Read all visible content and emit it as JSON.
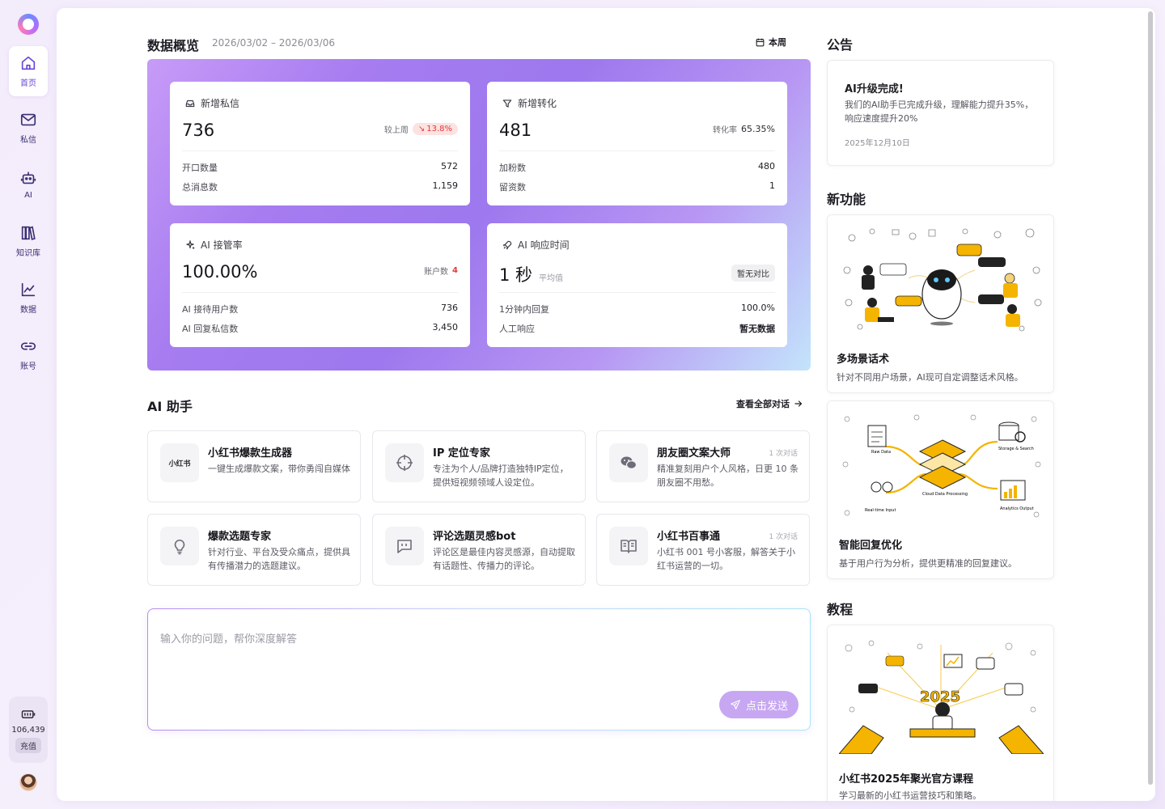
{
  "sidebar": {
    "items": [
      {
        "label": "首页",
        "icon": "home-icon",
        "active": true
      },
      {
        "label": "私信",
        "icon": "mail-icon"
      },
      {
        "label": "AI",
        "icon": "robot-icon"
      },
      {
        "label": "知识库",
        "icon": "books-icon"
      },
      {
        "label": "数据",
        "icon": "chart-line-icon"
      },
      {
        "label": "账号",
        "icon": "link-icon"
      }
    ],
    "credits": {
      "value": "106,439",
      "recharge_label": "充值"
    }
  },
  "overview": {
    "title": "数据概览",
    "date_range": "2026/03/02 – 2026/03/06",
    "period_button": "本周",
    "cards": [
      {
        "title": "新增私信",
        "value": "736",
        "meta_label": "较上周",
        "trend": "13.8%",
        "rows": [
          {
            "k": "开口数量",
            "v": "572"
          },
          {
            "k": "总消息数",
            "v": "1,159"
          }
        ]
      },
      {
        "title": "新增转化",
        "value": "481",
        "meta_label": "转化率",
        "meta_value": "65.35%",
        "rows": [
          {
            "k": "加粉数",
            "v": "480"
          },
          {
            "k": "留资数",
            "v": "1"
          }
        ]
      },
      {
        "title": "AI 接管率",
        "value": "100.00%",
        "meta_label": "账户数",
        "meta_value": "4",
        "rows": [
          {
            "k": "AI 接待用户数",
            "v": "736"
          },
          {
            "k": "AI 回复私信数",
            "v": "3,450"
          }
        ]
      },
      {
        "title": "AI 响应时间",
        "value": "1 秒",
        "value_sub": "平均值",
        "meta_badge": "暂无对比",
        "rows": [
          {
            "k": "1分钟内回复",
            "v": "100.0%"
          },
          {
            "k": "人工响应",
            "v": "暂无数据"
          }
        ]
      }
    ]
  },
  "assistant": {
    "title": "AI 助手",
    "view_all": "查看全部对话",
    "tools": [
      {
        "title": "小红书爆款生成器",
        "desc": "一键生成爆款文案，带你勇闯自媒体",
        "icon_text": "小红书",
        "count": ""
      },
      {
        "title": "IP 定位专家",
        "desc": "专注为个人/品牌打造独特IP定位，提供短视频领域人设定位。",
        "icon": "crosshair-icon",
        "count": ""
      },
      {
        "title": "朋友圈文案大师",
        "desc": "精准复刻用户个人风格，日更 10 条朋友圈不用愁。",
        "icon": "wechat-icon",
        "count": "1 次对话"
      },
      {
        "title": "爆款选题专家",
        "desc": "针对行业、平台及受众痛点，提供具有传播潜力的选题建议。",
        "icon": "lightbulb-icon",
        "count": ""
      },
      {
        "title": "评论选题灵感bot",
        "desc": "评论区是最佳内容灵感源，自动提取有话题性、传播力的评论。",
        "icon": "quote-bubble-icon",
        "count": ""
      },
      {
        "title": "小红书百事通",
        "desc": "小红书 001 号小客服，解答关于小红书运营的一切。",
        "icon": "open-book-icon",
        "count": "1 次对话"
      }
    ],
    "input_placeholder": "输入你的问题，帮你深度解答",
    "send_label": "点击发送"
  },
  "right": {
    "notice_title": "公告",
    "notice": {
      "heading": "AI升级完成!",
      "body": "我们的AI助手已完成升级，理解能力提升35%，响应速度提升20%",
      "date": "2025年12月10日"
    },
    "features_title": "新功能",
    "features": [
      {
        "title": "多场景话术",
        "desc": "针对不同用户场景，AI现可自定调整话术风格。"
      },
      {
        "title": "智能回复优化",
        "desc": "基于用户行为分析，提供更精准的回复建议。",
        "labels": [
          "Raw Data",
          "Storage & Search",
          "Cloud Data Processing",
          "Real-time Input",
          "Analytics Output"
        ]
      }
    ],
    "tutorial_title": "教程",
    "tutorial": {
      "title": "小红书2025年聚光官方课程",
      "desc": "学习最新的小红书运营技巧和策略。",
      "art_text": "2025"
    }
  },
  "colors": {
    "accent": "#9d78ee",
    "trend_down": "#e53935",
    "send": "#c7a7f2"
  }
}
